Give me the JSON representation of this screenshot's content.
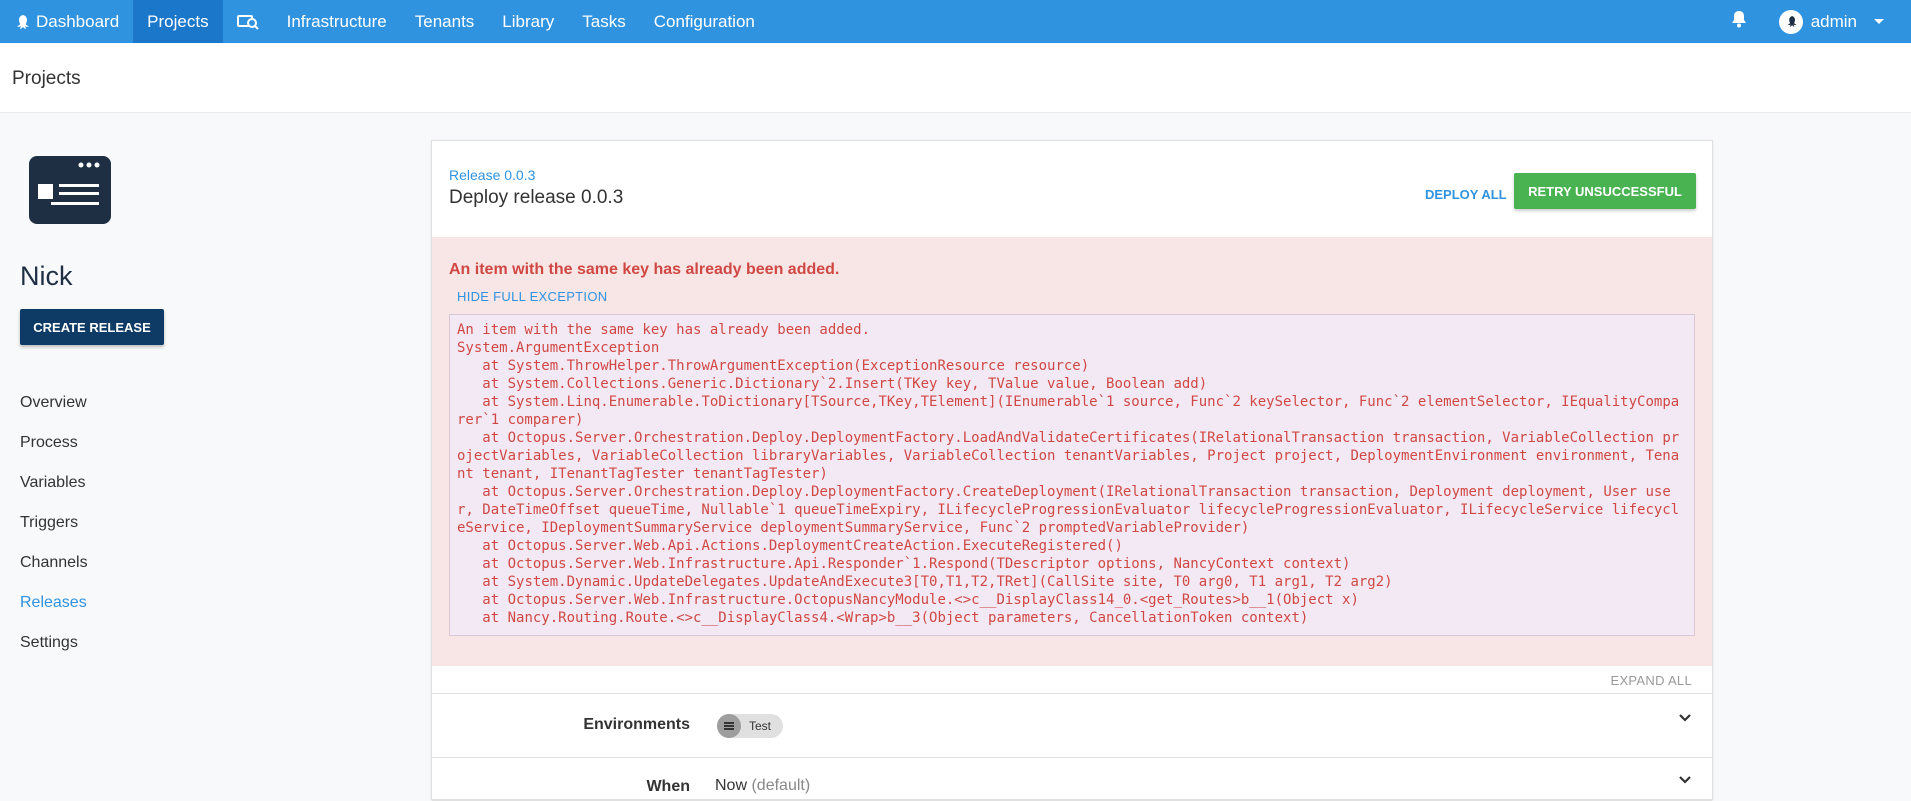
{
  "nav": {
    "items": [
      {
        "label": "Dashboard",
        "icon": "octopus-icon"
      },
      {
        "label": "Projects",
        "active": true
      },
      {
        "label": "",
        "icon": "search-machines-icon"
      },
      {
        "label": "Infrastructure"
      },
      {
        "label": "Tenants"
      },
      {
        "label": "Library"
      },
      {
        "label": "Tasks"
      },
      {
        "label": "Configuration"
      }
    ],
    "user": "admin",
    "colors": {
      "bar": "#2f93e0",
      "active": "#1a77c9"
    }
  },
  "page": {
    "title": "Projects"
  },
  "project": {
    "name": "Nick",
    "create_release_label": "CREATE RELEASE",
    "menu": [
      "Overview",
      "Process",
      "Variables",
      "Triggers",
      "Channels",
      "Releases",
      "Settings"
    ],
    "active_menu": "Releases"
  },
  "release": {
    "link": "Release 0.0.3",
    "title": "Deploy release 0.0.3",
    "deploy_all": "DEPLOY ALL",
    "retry": "RETRY UNSUCCESSFUL"
  },
  "error": {
    "title": "An item with the same key has already been added.",
    "toggle_label": "HIDE FULL EXCEPTION",
    "exception": "An item with the same key has already been added.\nSystem.ArgumentException\n   at System.ThrowHelper.ThrowArgumentException(ExceptionResource resource)\n   at System.Collections.Generic.Dictionary`2.Insert(TKey key, TValue value, Boolean add)\n   at System.Linq.Enumerable.ToDictionary[TSource,TKey,TElement](IEnumerable`1 source, Func`2 keySelector, Func`2 elementSelector, IEqualityComparer`1 comparer)\n   at Octopus.Server.Orchestration.Deploy.DeploymentFactory.LoadAndValidateCertificates(IRelationalTransaction transaction, VariableCollection projectVariables, VariableCollection libraryVariables, VariableCollection tenantVariables, Project project, DeploymentEnvironment environment, Tenant tenant, ITenantTagTester tenantTagTester)\n   at Octopus.Server.Orchestration.Deploy.DeploymentFactory.CreateDeployment(IRelationalTransaction transaction, Deployment deployment, User user, DateTimeOffset queueTime, Nullable`1 queueTimeExpiry, ILifecycleProgressionEvaluator lifecycleProgressionEvaluator, ILifecycleService lifecycleService, IDeploymentSummaryService deploymentSummaryService, Func`2 promptedVariableProvider)\n   at Octopus.Server.Web.Api.Actions.DeploymentCreateAction.ExecuteRegistered()\n   at Octopus.Server.Web.Infrastructure.Api.Responder`1.Respond(TDescriptor options, NancyContext context)\n   at System.Dynamic.UpdateDelegates.UpdateAndExecute3[T0,T1,T2,TRet](CallSite site, T0 arg0, T1 arg1, T2 arg2)\n   at Octopus.Server.Web.Infrastructure.OctopusNancyModule.<>c__DisplayClass14_0.<get_Routes>b__1(Object x)\n   at Nancy.Routing.Route.<>c__DisplayClass4.<Wrap>b__3(Object parameters, CancellationToken context)",
    "color": "#d04843"
  },
  "sections": {
    "expand_all": "EXPAND ALL",
    "environments_label": "Environments",
    "environment_chip": "Test",
    "when_label": "When",
    "when_value": "Now",
    "when_default": "(default)"
  }
}
